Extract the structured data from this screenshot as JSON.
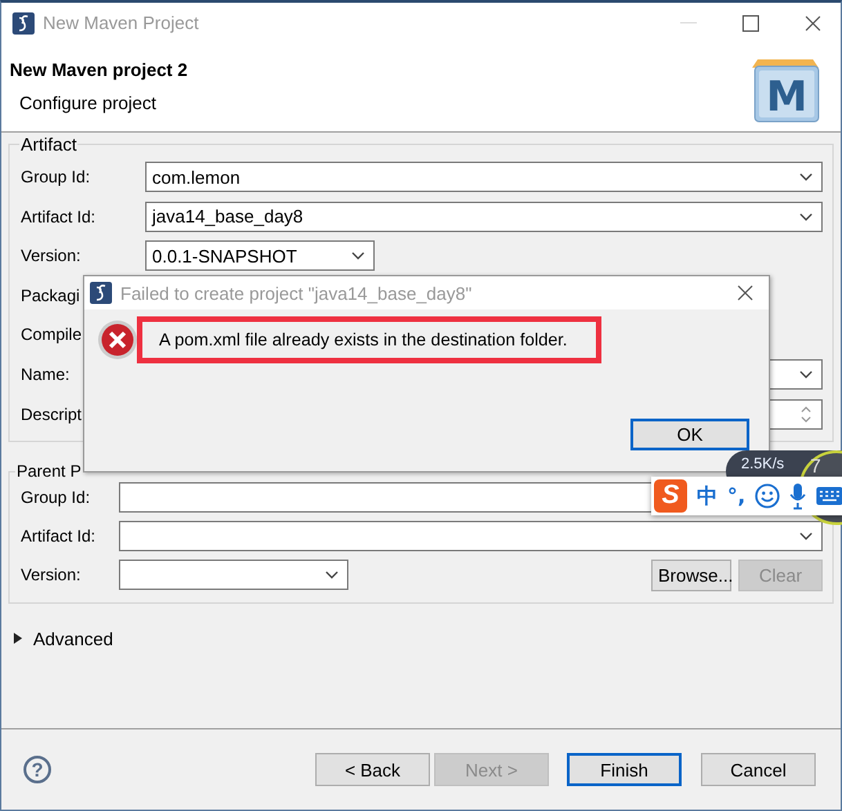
{
  "window": {
    "title": "New Maven Project"
  },
  "header": {
    "title": "New Maven project 2",
    "subtitle": "Configure project",
    "logo_letter": "M"
  },
  "artifact": {
    "legend": "Artifact",
    "fields": [
      {
        "label": "Group Id:",
        "kind": "combo",
        "value": "com.lemon"
      },
      {
        "label": "Artifact Id:",
        "kind": "combo",
        "value": "java14_base_day8"
      },
      {
        "label": "Version:",
        "kind": "short-combo",
        "value": "0.0.1-SNAPSHOT"
      },
      {
        "label": "Packagi",
        "kind": "hidden"
      },
      {
        "label": "Compile",
        "kind": "hidden"
      },
      {
        "label": "Name:",
        "kind": "combo"
      },
      {
        "label": "Descript",
        "kind": "spinner"
      }
    ]
  },
  "parent": {
    "legend": "Parent P",
    "fields": [
      {
        "label": "Group Id:",
        "kind": "text"
      },
      {
        "label": "Artifact Id:",
        "kind": "combo"
      },
      {
        "label": "Version:",
        "kind": "short-combo"
      }
    ],
    "buttons": [
      {
        "label": "Browse...",
        "disabled": false
      },
      {
        "label": "Clear",
        "disabled": true
      }
    ]
  },
  "advanced": {
    "label": "Advanced",
    "expanded": false
  },
  "footer": {
    "help": "?",
    "buttons": [
      {
        "label": "< Back",
        "disabled": false,
        "default": false
      },
      {
        "label": "Next >",
        "disabled": true,
        "default": false
      },
      {
        "label": "Finish",
        "disabled": false,
        "default": true
      },
      {
        "label": "Cancel",
        "disabled": false,
        "default": false
      }
    ]
  },
  "error_dialog": {
    "title": "Failed to create project \"java14_base_day8\"",
    "message": "A pom.xml file already exists in the destination folder.",
    "highlighted": true,
    "button": "OK"
  },
  "net_widget": {
    "speed": "2.5K/s",
    "reading": "7"
  },
  "ime_toolbar": {
    "logo": "S",
    "mode": "中",
    "punctuation": "°,"
  }
}
